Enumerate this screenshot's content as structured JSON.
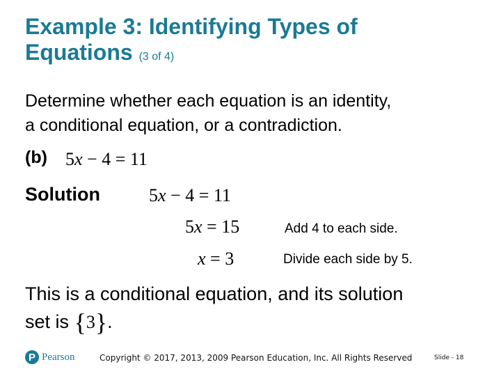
{
  "title": {
    "main_line1": "Example 3: Identifying Types of",
    "main_line2": "Equations",
    "part": "(3 of 4)"
  },
  "prompt": {
    "line1": "Determine whether each equation is an identity,",
    "line2": "a conditional equation, or a contradiction."
  },
  "problem": {
    "label": "(b)",
    "equation": {
      "lhs_coef": "5",
      "var": "x",
      "rest": " − 4 = 11"
    }
  },
  "solution": {
    "label": "Solution",
    "steps": [
      {
        "coef": "5",
        "var": "x",
        "rest": " − 4 = 11",
        "note": ""
      },
      {
        "coef": "5",
        "var": "x",
        "rest": " = 15",
        "note": "Add 4 to each side."
      },
      {
        "coef": "",
        "var": "x",
        "rest": " = 3",
        "note": "Divide each side by 5."
      }
    ]
  },
  "conclusion": {
    "line1": "This is a conditional equation, and its solution",
    "line2_prefix": "set is ",
    "set_open": "{",
    "set_value": "3",
    "set_close": "}",
    "line2_suffix": "."
  },
  "footer": {
    "logo_letter": "P",
    "logo_text": "Pearson",
    "copyright": "Copyright © 2017, 2013, 2009 Pearson Education, Inc. All Rights Reserved",
    "slide": "Slide - 18"
  },
  "colors": {
    "accent": "#1b7a95"
  }
}
